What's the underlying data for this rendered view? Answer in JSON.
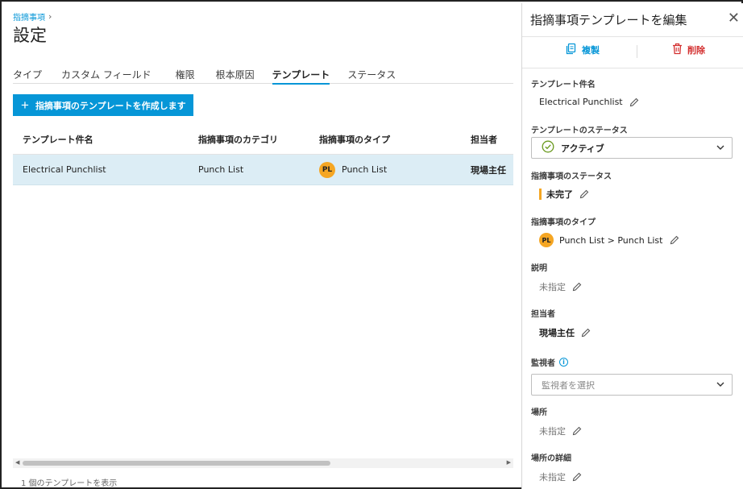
{
  "breadcrumb": {
    "parent": "指摘事項"
  },
  "page": {
    "title": "設定"
  },
  "tabs": [
    {
      "label": "タイプ",
      "active": false
    },
    {
      "label": "カスタム フィールド",
      "active": false
    },
    {
      "label": "権限",
      "active": false
    },
    {
      "label": "根本原因",
      "active": false
    },
    {
      "label": "テンプレート",
      "active": true
    },
    {
      "label": "ステータス",
      "active": false
    }
  ],
  "create_button": {
    "label": "指摘事項のテンプレートを作成します"
  },
  "table": {
    "headers": [
      "テンプレート件名",
      "指摘事項のカテゴリ",
      "指摘事項のタイプ",
      "担当者"
    ],
    "rows": [
      {
        "name": "Electrical Punchlist",
        "category": "Punch List",
        "type_badge": "PL",
        "type": "Punch List",
        "assignee": "現場主任"
      }
    ]
  },
  "footer": {
    "count_text": "1 個のテンプレートを表示"
  },
  "panel": {
    "title": "指摘事項テンプレートを編集",
    "duplicate_label": "複製",
    "delete_label": "削除",
    "fields": {
      "template_name": {
        "label": "テンプレート件名",
        "value": "Electrical Punchlist"
      },
      "template_status": {
        "label": "テンプレートのステータス",
        "value": "アクティブ"
      },
      "issue_status": {
        "label": "指摘事項のステータス",
        "value": "未完了"
      },
      "issue_type": {
        "label": "指摘事項のタイプ",
        "badge": "PL",
        "value": "Punch List > Punch List"
      },
      "description": {
        "label": "説明",
        "value": "未指定"
      },
      "assignee": {
        "label": "担当者",
        "value": "現場主任"
      },
      "watchers": {
        "label": "監視者",
        "placeholder": "監視者を選択"
      },
      "location": {
        "label": "場所",
        "value": "未指定"
      },
      "location_details": {
        "label": "場所の詳細",
        "value": "未指定"
      }
    }
  },
  "colors": {
    "accent": "#0696d7",
    "selected_row": "#dcedf5",
    "badge": "#f5a623",
    "danger": "#d32f2f",
    "active_status": "#6a9a1f"
  }
}
